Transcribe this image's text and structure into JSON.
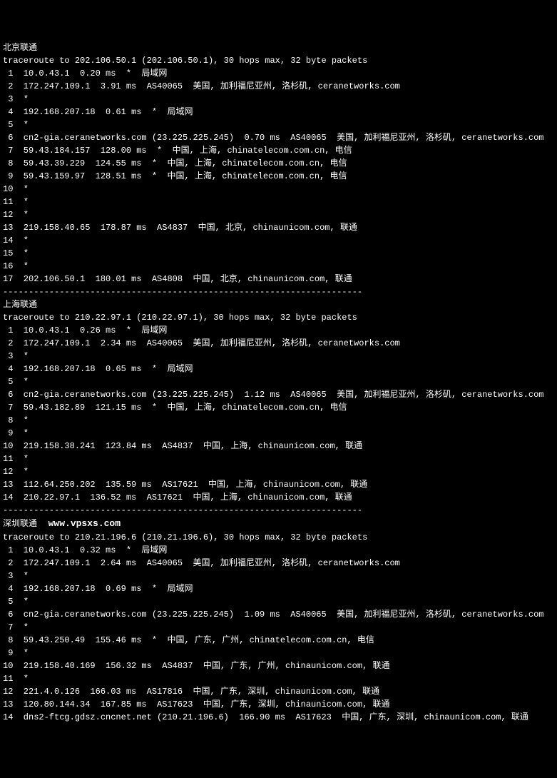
{
  "sections": [
    {
      "title": "北京联通",
      "header": "traceroute to 202.106.50.1 (202.106.50.1), 30 hops max, 32 byte packets",
      "hops": [
        " 1  10.0.43.1  0.20 ms  *  局域网",
        " 2  172.247.109.1  3.91 ms  AS40065  美国, 加利福尼亚州, 洛杉矶, ceranetworks.com",
        " 3  *",
        " 4  192.168.207.18  0.61 ms  *  局域网",
        " 5  *",
        " 6  cn2-gia.ceranetworks.com (23.225.225.245)  0.70 ms  AS40065  美国, 加利福尼亚州, 洛杉矶, ceranetworks.com",
        " 7  59.43.184.157  128.00 ms  *  中国, 上海, chinatelecom.com.cn, 电信",
        " 8  59.43.39.229  124.55 ms  *  中国, 上海, chinatelecom.com.cn, 电信",
        " 9  59.43.159.97  128.51 ms  *  中国, 上海, chinatelecom.com.cn, 电信",
        "10  *",
        "11  *",
        "12  *",
        "13  219.158.40.65  178.87 ms  AS4837  中国, 北京, chinaunicom.com, 联通",
        "14  *",
        "15  *",
        "16  *",
        "17  202.106.50.1  180.01 ms  AS4808  中国, 北京, chinaunicom.com, 联通"
      ]
    },
    {
      "title": "上海联通",
      "header": "traceroute to 210.22.97.1 (210.22.97.1), 30 hops max, 32 byte packets",
      "hops": [
        " 1  10.0.43.1  0.26 ms  *  局域网",
        " 2  172.247.109.1  2.34 ms  AS40065  美国, 加利福尼亚州, 洛杉矶, ceranetworks.com",
        " 3  *",
        " 4  192.168.207.18  0.65 ms  *  局域网",
        " 5  *",
        " 6  cn2-gia.ceranetworks.com (23.225.225.245)  1.12 ms  AS40065  美国, 加利福尼亚州, 洛杉矶, ceranetworks.com",
        " 7  59.43.182.89  121.15 ms  *  中国, 上海, chinatelecom.com.cn, 电信",
        " 8  *",
        " 9  *",
        "10  219.158.38.241  123.84 ms  AS4837  中国, 上海, chinaunicom.com, 联通",
        "11  *",
        "12  *",
        "13  112.64.250.202  135.59 ms  AS17621  中国, 上海, chinaunicom.com, 联通",
        "14  210.22.97.1  136.52 ms  AS17621  中国, 上海, chinaunicom.com, 联通"
      ]
    },
    {
      "title": "深圳联通",
      "watermark": "www.vpsxs.com",
      "header": "traceroute to 210.21.196.6 (210.21.196.6), 30 hops max, 32 byte packets",
      "hops": [
        " 1  10.0.43.1  0.32 ms  *  局域网",
        " 2  172.247.109.1  2.64 ms  AS40065  美国, 加利福尼亚州, 洛杉矶, ceranetworks.com",
        " 3  *",
        " 4  192.168.207.18  0.69 ms  *  局域网",
        " 5  *",
        " 6  cn2-gia.ceranetworks.com (23.225.225.245)  1.09 ms  AS40065  美国, 加利福尼亚州, 洛杉矶, ceranetworks.com",
        " 7  *",
        " 8  59.43.250.49  155.46 ms  *  中国, 广东, 广州, chinatelecom.com.cn, 电信",
        " 9  *",
        "10  219.158.40.169  156.32 ms  AS4837  中国, 广东, 广州, chinaunicom.com, 联通",
        "11  *",
        "12  221.4.0.126  166.03 ms  AS17816  中国, 广东, 深圳, chinaunicom.com, 联通",
        "13  120.80.144.34  167.85 ms  AS17623  中国, 广东, 深圳, chinaunicom.com, 联通",
        "14  dns2-ftcg.gdsz.cncnet.net (210.21.196.6)  166.90 ms  AS17623  中国, 广东, 深圳, chinaunicom.com, 联通"
      ]
    }
  ],
  "divider": "----------------------------------------------------------------------"
}
